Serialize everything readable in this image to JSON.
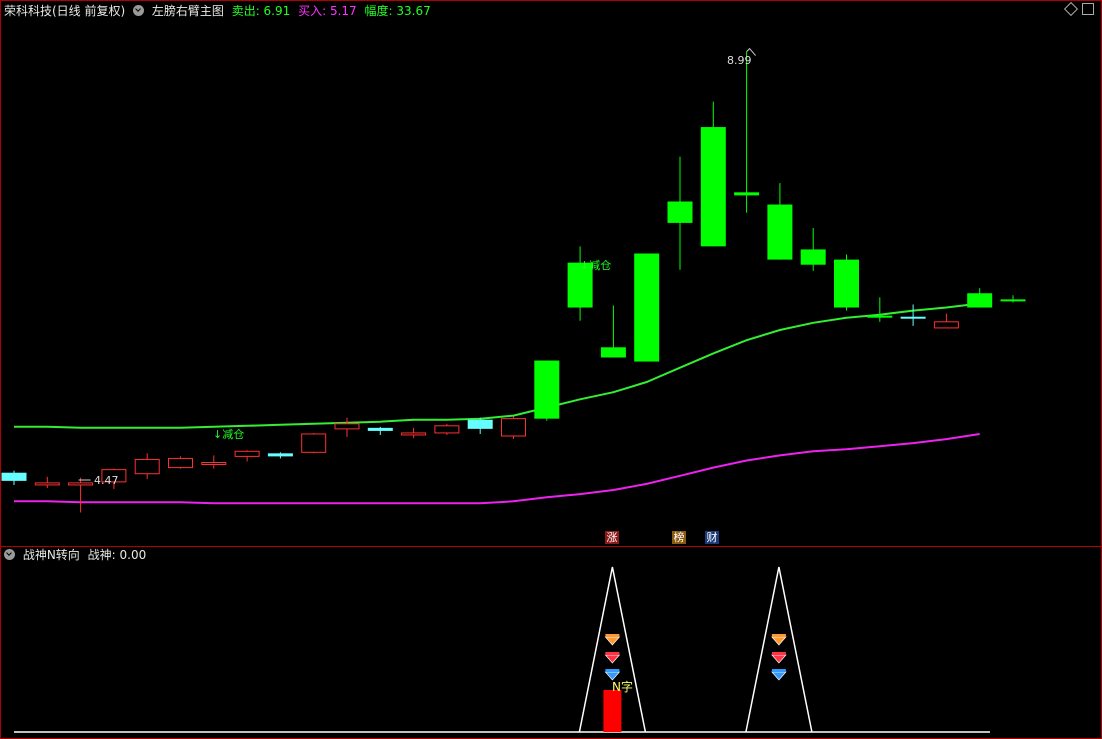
{
  "header": {
    "stock": "荣科科技(日线 前复权)",
    "indicator": "左膀右臂主图",
    "sell_label": "卖出: 6.91",
    "buy_label": "买入: 5.17",
    "range_label": "幅度: 33.67"
  },
  "sub_header": {
    "indicator": "战神N转向",
    "value_label": "战神: 0.00"
  },
  "annotations": {
    "high_price": "8.99",
    "low_price": "4.47",
    "signal_1": "↓减仓",
    "signal_2": "↓减仓",
    "n_pattern": "N字"
  },
  "badges": {
    "zhang": "涨",
    "bang": "榜",
    "cai": "财"
  },
  "colors": {
    "up": "#ff3030",
    "down_green": "#00ff00",
    "down_cyan": "#66ffff",
    "ma_green": "#33ee33",
    "ma_magenta": "#ee22ee",
    "border": "#b00000"
  },
  "chart_data": {
    "type": "candlestick",
    "candles": [
      {
        "o": 4.86,
        "c": 4.78,
        "h": 4.88,
        "l": 4.74,
        "s": "cyan"
      },
      {
        "o": 4.75,
        "c": 4.76,
        "h": 4.82,
        "l": 4.71,
        "s": "up"
      },
      {
        "o": 4.74,
        "c": 4.76,
        "h": 4.81,
        "l": 4.47,
        "s": "up"
      },
      {
        "o": 4.77,
        "c": 4.89,
        "h": 4.9,
        "l": 4.7,
        "s": "up"
      },
      {
        "o": 4.85,
        "c": 4.99,
        "h": 5.05,
        "l": 4.8,
        "s": "up"
      },
      {
        "o": 4.91,
        "c": 5.0,
        "h": 5.02,
        "l": 4.9,
        "s": "up"
      },
      {
        "o": 4.95,
        "c": 4.96,
        "h": 5.03,
        "l": 4.9,
        "s": "up"
      },
      {
        "o": 5.02,
        "c": 5.07,
        "h": 5.08,
        "l": 4.97,
        "s": "up"
      },
      {
        "o": 5.05,
        "c": 5.02,
        "h": 5.06,
        "l": 5.0,
        "s": "cyan"
      },
      {
        "o": 5.06,
        "c": 5.24,
        "h": 5.25,
        "l": 5.05,
        "s": "up"
      },
      {
        "o": 5.29,
        "c": 5.34,
        "h": 5.4,
        "l": 5.21,
        "s": "up"
      },
      {
        "o": 5.3,
        "c": 5.27,
        "h": 5.31,
        "l": 5.23,
        "s": "cyan"
      },
      {
        "o": 5.25,
        "c": 5.25,
        "h": 5.3,
        "l": 5.2,
        "s": "up"
      },
      {
        "o": 5.25,
        "c": 5.32,
        "h": 5.34,
        "l": 5.23,
        "s": "up"
      },
      {
        "o": 5.38,
        "c": 5.29,
        "h": 5.4,
        "l": 5.24,
        "s": "cyan"
      },
      {
        "o": 5.22,
        "c": 5.39,
        "h": 5.41,
        "l": 5.19,
        "s": "up"
      },
      {
        "o": 5.96,
        "c": 5.39,
        "h": 5.96,
        "l": 5.37,
        "s": "down"
      },
      {
        "o": 6.92,
        "c": 6.48,
        "h": 7.08,
        "l": 6.35,
        "s": "down"
      },
      {
        "o": 6.09,
        "c": 5.99,
        "h": 6.5,
        "l": 5.99,
        "s": "down"
      },
      {
        "o": 7.01,
        "c": 5.95,
        "h": 7.01,
        "l": 5.95,
        "s": "down"
      },
      {
        "o": 7.52,
        "c": 7.31,
        "h": 7.96,
        "l": 6.85,
        "s": "down"
      },
      {
        "o": 8.25,
        "c": 7.08,
        "h": 8.5,
        "l": 7.08,
        "s": "down"
      },
      {
        "o": 7.61,
        "c": 7.58,
        "h": 8.99,
        "l": 7.41,
        "s": "down"
      },
      {
        "o": 7.49,
        "c": 6.95,
        "h": 7.7,
        "l": 6.95,
        "s": "down"
      },
      {
        "o": 7.05,
        "c": 6.9,
        "h": 7.26,
        "l": 6.84,
        "s": "down"
      },
      {
        "o": 6.95,
        "c": 6.48,
        "h": 7.0,
        "l": 6.45,
        "s": "down"
      },
      {
        "o": 6.4,
        "c": 6.39,
        "h": 6.58,
        "l": 6.34,
        "s": "down"
      },
      {
        "o": 6.39,
        "c": 6.38,
        "h": 6.51,
        "l": 6.3,
        "s": "cyan"
      },
      {
        "o": 6.28,
        "c": 6.34,
        "h": 6.42,
        "l": 6.34,
        "s": "up"
      },
      {
        "o": 6.62,
        "c": 6.48,
        "h": 6.67,
        "l": 6.48,
        "s": "down"
      },
      {
        "o": 6.56,
        "c": 6.56,
        "h": 6.6,
        "l": 6.53,
        "s": "down"
      }
    ],
    "ma_fast": [
      5.31,
      5.31,
      5.3,
      5.3,
      5.3,
      5.3,
      5.31,
      5.32,
      5.33,
      5.34,
      5.35,
      5.36,
      5.38,
      5.38,
      5.39,
      5.42,
      5.5,
      5.58,
      5.65,
      5.75,
      5.89,
      6.03,
      6.16,
      6.26,
      6.33,
      6.38,
      6.41,
      6.45,
      6.48,
      6.52
    ],
    "ma_slow": [
      4.58,
      4.58,
      4.57,
      4.57,
      4.57,
      4.57,
      4.56,
      4.56,
      4.56,
      4.56,
      4.56,
      4.56,
      4.56,
      4.56,
      4.56,
      4.58,
      4.62,
      4.65,
      4.69,
      4.75,
      4.83,
      4.91,
      4.98,
      5.03,
      5.07,
      5.09,
      5.12,
      5.15,
      5.19,
      5.24
    ],
    "y_range": [
      4.2,
      9.3
    ],
    "sub_indicator": {
      "name": "战神N转向",
      "peaks_at_candle": [
        18,
        23
      ],
      "n_signal_candle": 18
    }
  }
}
